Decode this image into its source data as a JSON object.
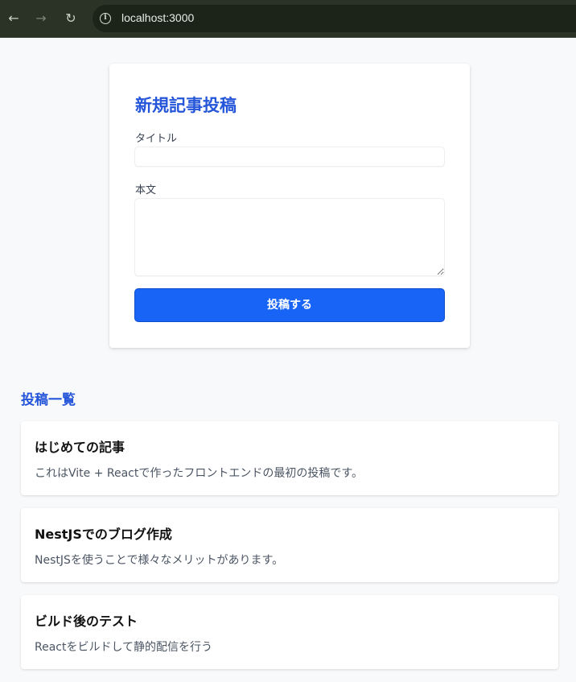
{
  "browser": {
    "url": "localhost:3000",
    "icons": {
      "back": "arrow-left-icon",
      "forward": "arrow-right-icon",
      "reload": "reload-icon",
      "info": "info-icon"
    }
  },
  "form": {
    "title": "新規記事投稿",
    "title_label": "タイトル",
    "title_value": "",
    "body_label": "本文",
    "body_value": "",
    "submit_label": "投稿する"
  },
  "post_list": {
    "heading": "投稿一覧",
    "posts": [
      {
        "title": "はじめての記事",
        "content": "これはVite + Reactで作ったフロントエンドの最初の投稿です。"
      },
      {
        "title": "NestJSでのブログ作成",
        "content": "NestJSを使うことで様々なメリットがあります。"
      },
      {
        "title": "ビルド後のテスト",
        "content": "Reactをビルドして静的配信を行う"
      }
    ]
  },
  "colors": {
    "accent": "#2556d9",
    "button": "#1764f6",
    "page_background": "#f8f9fb",
    "browser_chrome": "#2a3326"
  }
}
